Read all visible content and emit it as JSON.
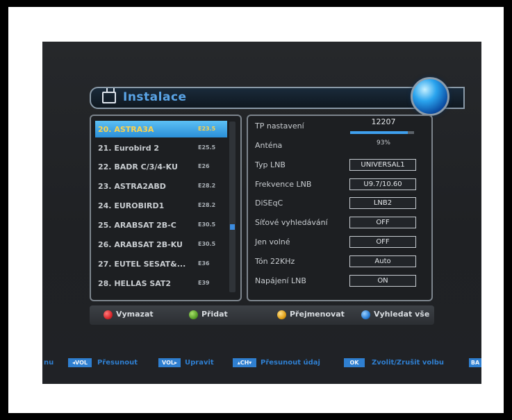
{
  "header": {
    "title": "Instalace"
  },
  "satellites": [
    {
      "name": "20. ASTRA3A",
      "pos": "E23.5",
      "selected": true
    },
    {
      "name": "21. Eurobird 2",
      "pos": "E25.5"
    },
    {
      "name": "22. BADR C/3/4-KU",
      "pos": "E26"
    },
    {
      "name": "23. ASTRA2ABD",
      "pos": "E28.2"
    },
    {
      "name": "24. EUROBIRD1",
      "pos": "E28.2"
    },
    {
      "name": "25. ARABSAT 2B-C",
      "pos": "E30.5"
    },
    {
      "name": "26. ARABSAT 2B-KU",
      "pos": "E30.5"
    },
    {
      "name": "27. EUTEL SESAT&...",
      "pos": "E36"
    },
    {
      "name": "28. HELLAS SAT2",
      "pos": "E39"
    }
  ],
  "settings": {
    "tp": {
      "label": "TP nastavení",
      "value": "12207",
      "progress": 0.9
    },
    "antenna": {
      "label": "Anténa",
      "value": "93%"
    },
    "lnb_type": {
      "label": "Typ LNB",
      "value": "UNIVERSAL1"
    },
    "lnb_freq": {
      "label": "Frekvence LNB",
      "value": "U9.7/10.60"
    },
    "diseqc": {
      "label": "DiSEqC",
      "value": "LNB2"
    },
    "network_search": {
      "label": "Síťové vyhledávání",
      "value": "OFF"
    },
    "free_only": {
      "label": "Jen volné",
      "value": "OFF"
    },
    "tone22": {
      "label": "Tón 22KHz",
      "value": "Auto"
    },
    "lnb_power": {
      "label": "Napájení LNB",
      "value": "ON"
    }
  },
  "color_keys": [
    {
      "label": "Vymazat",
      "color": "#d9262b"
    },
    {
      "label": "Přidat",
      "color": "#5aa12a"
    },
    {
      "label": "Přejmenovat",
      "color": "#e0a018"
    },
    {
      "label": "Vyhledat vše",
      "color": "#2a7fd8"
    }
  ],
  "help": {
    "left_text": "nu",
    "vol_left_chip": "◂VOL",
    "vol_left_text": "Přesunout",
    "vol_right_chip": "VOL▸",
    "vol_right_text": "Upravit",
    "ch_chip": "▴CH▾",
    "ch_text": "Přesunout údaj",
    "ok_chip": "OK",
    "ok_text": "Zvolit/Zrušit volbu",
    "back_chip": "BA"
  }
}
